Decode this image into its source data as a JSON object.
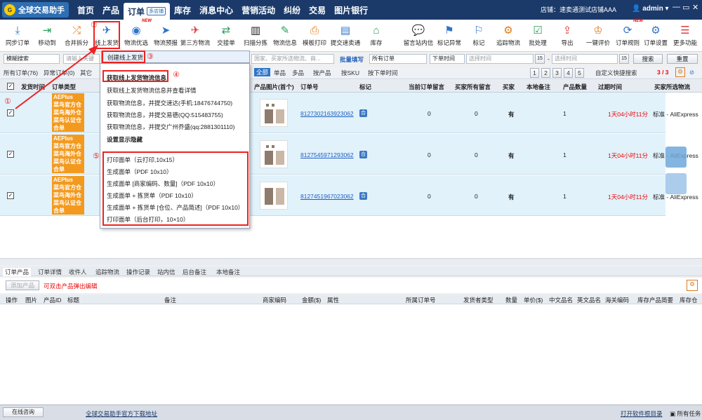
{
  "topbar": {
    "logo": "全球交易助手",
    "nav": [
      "首页",
      "产品",
      "订单",
      "库存",
      "消息中心",
      "营销活动",
      "纠纷",
      "交易",
      "图片银行"
    ],
    "order_tag": "多店铺",
    "store": "店铺：速卖通测试店铺AAA",
    "user": "admin"
  },
  "toolbar": {
    "items": [
      "同步订单",
      "移动到",
      "合并拆分",
      "线上发货",
      "物流优选",
      "物流预报",
      "第三方物流",
      "交接单",
      "扫描分拣",
      "物流信息",
      "模板打印",
      "提交速卖通",
      "库存",
      "留言站内信",
      "标记异常",
      "标记",
      "追踪物流",
      "批处理",
      "导出",
      "一键评价",
      "订单规则",
      "订单设置",
      "更多功能"
    ],
    "new_label": "NEW"
  },
  "filter": {
    "search_type": "模糊搜索",
    "search_placeholder": "请输入关键",
    "mid_placeholder": "国家、买家所选物流、商...",
    "batch": "批量填写",
    "all_orders": "所有订单",
    "order_time": "下单时间",
    "date_placeholder": "选择时间",
    "cal": "15",
    "search_btn": "搜索",
    "reset_btn": "重置"
  },
  "tabs2": {
    "all": "所有订单(76)",
    "abnormal": "异常订单(0)",
    "other": "其它",
    "quick": [
      "全部",
      "单品",
      "多品"
    ],
    "by_product": "按产品",
    "by_sku": "按SKU",
    "by_time": "按下单时间",
    "pages": [
      "1",
      "2",
      "3",
      "4",
      "5"
    ],
    "custom_search": "自定义快捷搜索",
    "page_info": "3 / 3"
  },
  "grid": {
    "headers": [
      "发货时间",
      "订单类型",
      "产品图片(首个)",
      "订单号",
      "标记",
      "当前订单留言",
      "买家所有留言",
      "买家",
      "本地备注",
      "产品数量",
      "过期时间",
      "买家所选物流"
    ],
    "badge_lines": [
      "AEPlus",
      "菜鸟官方仓",
      "菜鸟海外仓",
      "菜鸟认证仓",
      "合单"
    ],
    "rows": [
      {
        "order_no": "8127302163923062",
        "mark": "合",
        "msg1": "0",
        "msg2": "0",
        "buyer": "有",
        "qty": "1",
        "expire": "1天04小时11分",
        "logistics": "标准 - AliExpress"
      },
      {
        "order_no": "8127545971293062",
        "mark": "合",
        "msg1": "0",
        "msg2": "0",
        "buyer": "有",
        "qty": "1",
        "expire": "1天04小时11分",
        "logistics": "标准 - AliExpress"
      },
      {
        "order_no": "8127451967023062",
        "mark": "合",
        "msg1": "0",
        "msg2": "0",
        "buyer": "有",
        "qty": "1",
        "expire": "1天04小时11分",
        "logistics": "标准 - AliExpress"
      }
    ]
  },
  "bottom_tabs": [
    "订单产品",
    "订单详情",
    "收件人",
    "追踪物流",
    "操作记录",
    "站内信",
    "后台备注",
    "本地备注"
  ],
  "add_product": "添加产品",
  "dbl_click_tip": "可双击产品弹出编辑",
  "bottom_headers": [
    "操作",
    "图片",
    "产品ID",
    "标题",
    "备注",
    "商家编码",
    "金额($)",
    "属性",
    "所属订单号",
    "发货者类型",
    "数量",
    "单价($)",
    "中文品名",
    "英文品名",
    "海关编码",
    "库存产品简要",
    "库存仓"
  ],
  "status": {
    "online": "在线咨询",
    "download": "全球交易助手官方下载地址",
    "open_dir": "打开软件根目录",
    "tasks": "所有任务"
  },
  "menu": {
    "submenu_item": "创建线上发货",
    "items": [
      "获取线上发货物流信息",
      "获取线上发货物流信息并查看详情",
      "获取物流信息，并提交速达(手机:18476744750)",
      "获取物流信息，并提交易德(QQ:515483755)",
      "获取物流信息，并提交广州乔盛(qq:2881301110)",
      "设置显示隐藏",
      "打印面单（云打印,10x15）",
      "生成面单（PDF 10x10）",
      "生成面单 [商家编码、数量]（PDF 10x10）",
      "生成面单 + 拣货单（PDF 10x10）",
      "生成面单 + 拣货单 [仓位、产品简述]（PDF 10x10）",
      "打印面单（后台打印，10×10）"
    ]
  },
  "annotations": [
    "①",
    "②",
    "③",
    "④",
    "⑤"
  ],
  "colors": {
    "topbar": "#1b3a6a",
    "accent": "#e22222",
    "badge": "#f39a1e",
    "row": "#e1f2fb"
  }
}
